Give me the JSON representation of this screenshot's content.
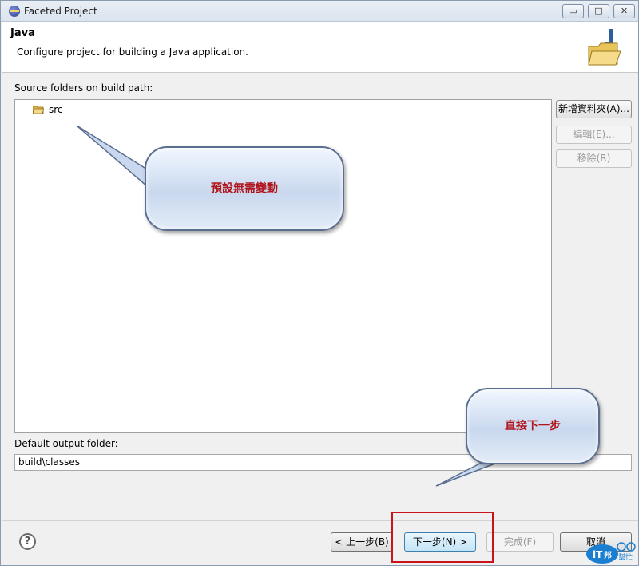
{
  "window": {
    "title": "Faceted Project",
    "min_glyph": "▭",
    "max_glyph": "□",
    "close_glyph": "✕"
  },
  "header": {
    "title": "Java",
    "description": "Configure project for building a Java application."
  },
  "source_folders": {
    "label": "Source folders on build path:",
    "items": [
      {
        "name": "src",
        "icon": "source-folder-icon"
      }
    ]
  },
  "side_buttons": {
    "add_folder": "新增資料夾(A)...",
    "edit": "編輯(E)...",
    "remove": "移除(R)"
  },
  "output": {
    "label": "Default output folder:",
    "value": "build\\classes"
  },
  "footer": {
    "help_glyph": "?",
    "back": "< 上一步(B)",
    "next": "下一步(N) >",
    "finish": "完成(F)",
    "cancel": "取消"
  },
  "annotations": {
    "callout_default": "預設無需變動",
    "callout_next": "直接下一步",
    "highlight_color": "#c8141a"
  },
  "watermark": {
    "text": "iT邦幫忙"
  }
}
